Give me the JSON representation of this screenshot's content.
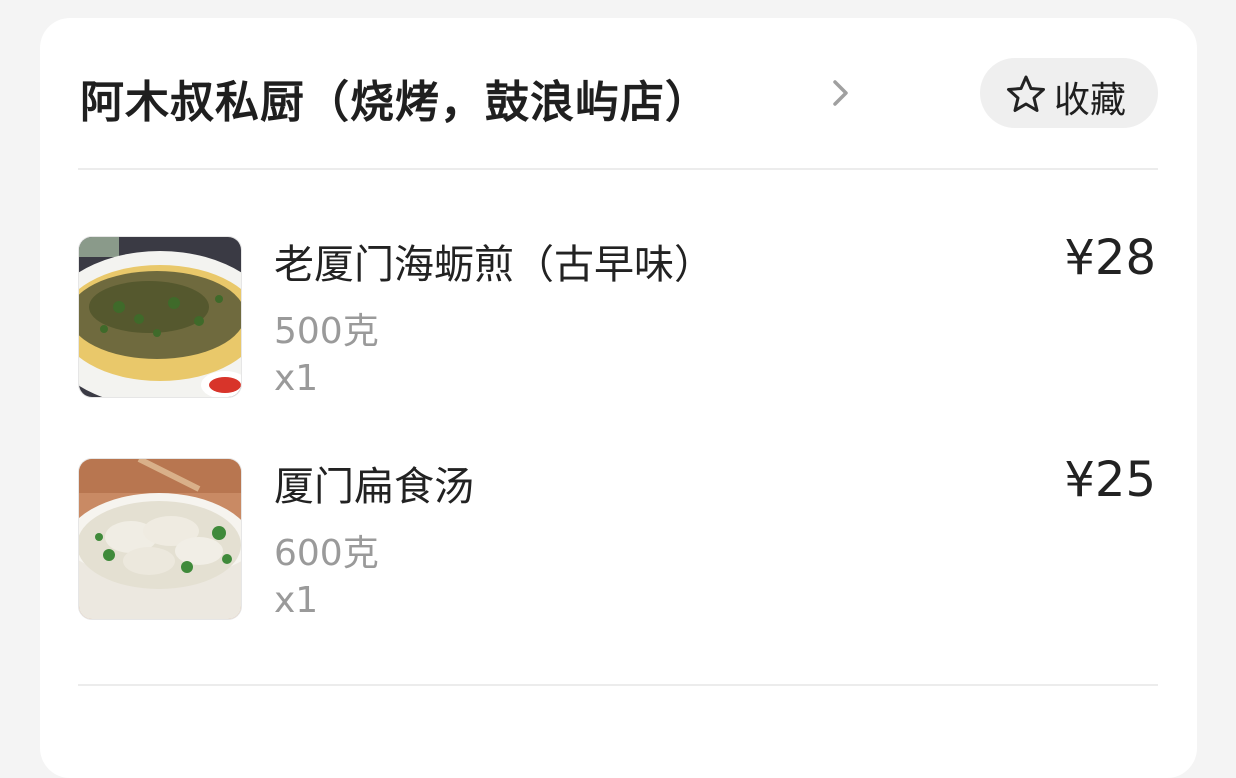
{
  "store": {
    "name": "阿木叔私厨（烧烤，鼓浪屿店）",
    "favorite_label": "收藏"
  },
  "items": [
    {
      "name": "老厦门海蛎煎（古早味）",
      "spec": "500克",
      "qty": "x1",
      "price": "¥28",
      "image": "oyster-omelette-photo"
    },
    {
      "name": "厦门扁食汤",
      "spec": "600克",
      "qty": "x1",
      "price": "¥25",
      "image": "wonton-soup-photo"
    }
  ],
  "icons": {
    "chevron": "chevron-right-icon",
    "favorite": "star-outline-icon"
  },
  "colors": {
    "background": "#f4f4f4",
    "card": "#ffffff",
    "text_primary": "#222222",
    "text_secondary": "#9a9a9a",
    "button_bg": "#efefef"
  }
}
